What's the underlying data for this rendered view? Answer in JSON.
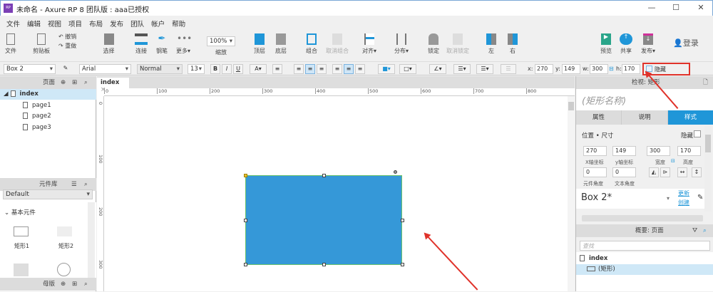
{
  "window": {
    "title": "未命名 - Axure RP 8 团队版 : aaa已授权",
    "logo": "RP",
    "minimize": "—",
    "maximize": "☐",
    "close": "✕"
  },
  "menu": [
    "文件",
    "编辑",
    "视图",
    "项目",
    "布局",
    "发布",
    "团队",
    "帐户",
    "帮助"
  ],
  "toolbar": {
    "file": "文件",
    "clipboard": "剪贴板",
    "undo": "撤销",
    "redo": "重做",
    "select": "选择",
    "connect": "连接",
    "pen": "钢笔",
    "more": "更多▾",
    "zoom": "100%",
    "zoom_label": "缩放",
    "top": "顶层",
    "bottom": "底层",
    "group": "组合",
    "ungroup": "取消组合",
    "align": "对齐▾",
    "distribute": "分布▾",
    "lock": "锁定",
    "unlock": "取消锁定",
    "left": "左",
    "right": "右",
    "preview": "预览",
    "share": "共享",
    "publish": "发布▾",
    "login": "登录"
  },
  "format": {
    "widget_style": "Box 2",
    "font": "Arial",
    "weight": "Normal",
    "size": "13",
    "bold": "B",
    "italic": "I",
    "underline": "U",
    "x_label": "x:",
    "x": "270",
    "y_label": "y:",
    "y": "149",
    "w_label": "w:",
    "w": "300",
    "h_label": "h:",
    "h": "170",
    "hidden": "隐藏"
  },
  "pages": {
    "title": "页面",
    "root": "index",
    "items": [
      "page1",
      "page2",
      "page3"
    ]
  },
  "library": {
    "title": "元件库",
    "selected": "Default",
    "group": "基本元件",
    "items": [
      "矩形1",
      "矩形2"
    ]
  },
  "masters": {
    "title": "母版"
  },
  "canvas": {
    "tab": "index",
    "tab_close": "×",
    "ruler_h": [
      "0",
      "100",
      "200",
      "300",
      "400",
      "500",
      "600",
      "700",
      "800"
    ],
    "ruler_v": [
      "0",
      "100",
      "200",
      "300"
    ],
    "shape_color": "#3598d8"
  },
  "inspector": {
    "title": "检视: 矩形",
    "name_placeholder": "(矩形名称)",
    "tabs": [
      "属性",
      "说明",
      "样式"
    ],
    "section": "位置 • 尺寸",
    "hidden": "隐藏",
    "x": "270",
    "y": "149",
    "w": "300",
    "h": "170",
    "x_label": "X轴坐标",
    "y_label": "y轴坐标",
    "w_label": "宽度",
    "h_label": "高度",
    "rot": "0",
    "text_rot": "0",
    "rot_label": "元件角度",
    "text_rot_label": "文本角度",
    "style_name": "Box 2*",
    "update": "更新",
    "create": "创建"
  },
  "outline": {
    "title": "概要: 页面",
    "search_placeholder": "查找",
    "root": "index",
    "item": "(矩形)"
  },
  "colors": {
    "accent": "#1f96d8",
    "annotation": "#e0322a"
  }
}
